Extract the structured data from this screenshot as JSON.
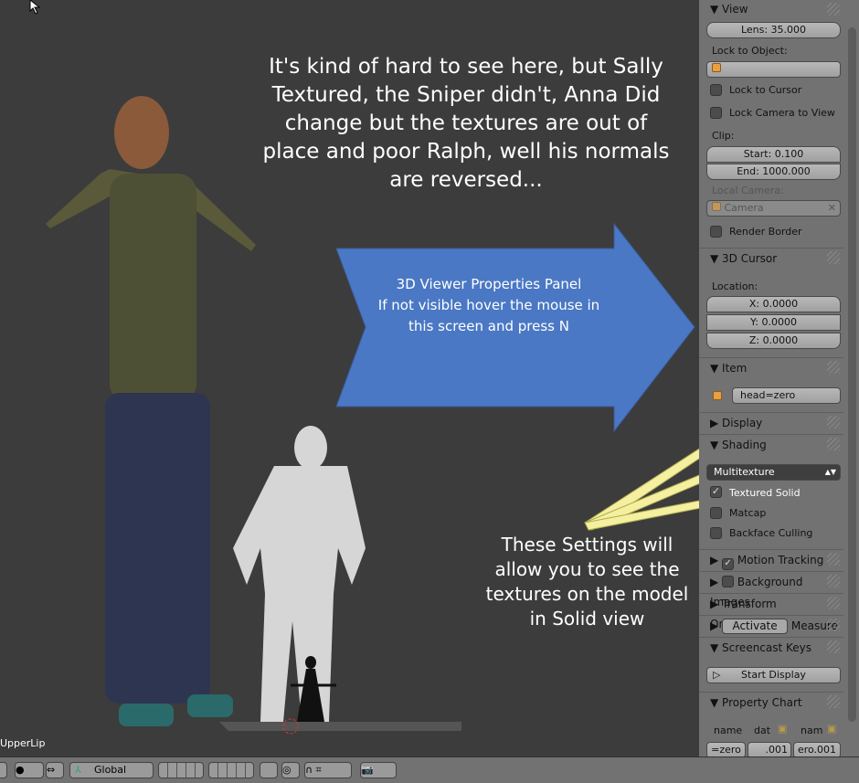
{
  "viewport": {
    "object_label": "UpperLip",
    "note_top": "It's kind of hard to see here, but Sally Textured, the Sniper didn't, Anna Did change but the textures are out of place and poor Ralph, well his normals are reversed...",
    "arrow_text": "3D Viewer Properties Panel\nIf not visible hover the mouse in this screen and press N",
    "note_bottom": "These Settings will allow you to see the textures on the model in Solid view",
    "arrow_color": "#4a78c4",
    "highlight_arrow_color": "#f4f0a0"
  },
  "panel": {
    "view_header": "View",
    "lens": "Lens: 35.000",
    "lock_to_object": "Lock to Object:",
    "lock_to_cursor": "Lock to Cursor",
    "lock_camera": "Lock Camera to View",
    "clip": "Clip:",
    "clip_start": "Start: 0.100",
    "clip_end": "End: 1000.000",
    "local_camera": "Local Camera:",
    "camera": "Camera",
    "render_border": "Render Border",
    "cursor_header": "3D Cursor",
    "location": "Location:",
    "x": "X: 0.0000",
    "y": "Y: 0.0000",
    "z": "Z: 0.0000",
    "item_header": "Item",
    "item_name": "head=zero",
    "display_header": "Display",
    "shading_header": "Shading",
    "shading_mode": "Multitexture",
    "textured_solid": "Textured Solid",
    "textured_solid_checked": true,
    "matcap": "Matcap",
    "backface": "Backface Culling",
    "motion_tracking": "Motion Tracking",
    "background_images": "Background Images",
    "transform_orientations": "Transform Orientations",
    "activate": "Activate",
    "measure": "Measure",
    "screencast_header": "Screencast Keys",
    "start_display": "Start Display",
    "property_chart_header": "Property Chart",
    "chart_cols": [
      "name",
      "dat",
      "nam"
    ],
    "chart_vals": [
      "=zero",
      ".001",
      "ero.001"
    ]
  },
  "toolbar": {
    "orientation": "Global"
  }
}
